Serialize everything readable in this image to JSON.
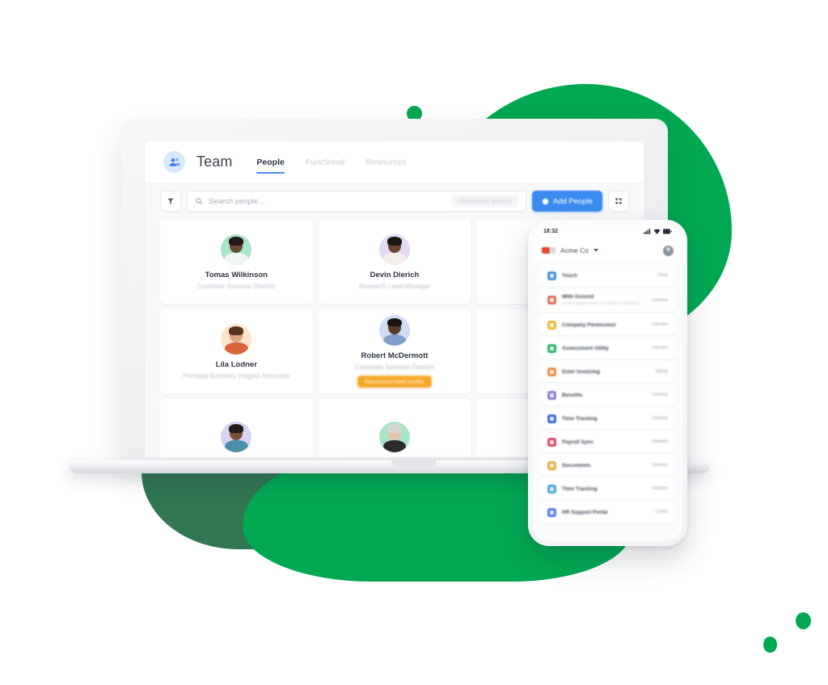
{
  "scene": {
    "brand_green": "#00a851",
    "accent_blue": "#3b8bf0",
    "badge_orange": "#f5a623"
  },
  "laptop_app": {
    "header": {
      "avatar_icon": "people-avatar-icon",
      "title": "Team",
      "tabs": [
        {
          "label": "People",
          "active": true
        },
        {
          "label": "Functional",
          "active": false
        },
        {
          "label": "Resources",
          "active": false
        }
      ]
    },
    "toolbar": {
      "filter_icon": "filter-icon",
      "search_icon": "search-icon",
      "search_value": "",
      "search_placeholder": "Search people...",
      "search_hint": "Advanced search",
      "add_icon": "plus-circle-icon",
      "add_label": "Add People",
      "grid_view_icon": "grid-view-icon"
    },
    "people": [
      {
        "name": "Tomas Wilkinson",
        "role": "Customer Success Director",
        "badge": "",
        "avatar_bg": "#a9e6c9",
        "skin": "#6b4a33",
        "hair": "#221a16",
        "shirt": "#f2f4f6"
      },
      {
        "name": "Devin Dierich",
        "role": "Research Lead Manager",
        "badge": "",
        "avatar_bg": "#e2daf4",
        "skin": "#6a4632",
        "hair": "#1c1614",
        "shirt": "#f5eee8"
      },
      {
        "name": "",
        "role": "",
        "badge": "",
        "avatar_bg": "#e8f0fb",
        "skin": "#c99a78",
        "hair": "#3a2b22",
        "shirt": "#eef1f5"
      },
      {
        "name": "Lila Lodner",
        "role": "Principal Business Insights Associate",
        "badge": "",
        "avatar_bg": "#fbe5cb",
        "skin": "#d9a882",
        "hair": "#5a3423",
        "shirt": "#d9653a"
      },
      {
        "name": "Robert McDermott",
        "role": "Corporate Services Director",
        "badge": "Recommended profile",
        "avatar_bg": "#cfddf6",
        "skin": "#5a3a28",
        "hair": "#171310",
        "shirt": "#7e9ec9"
      },
      {
        "name": "",
        "role": "",
        "badge": "",
        "avatar_bg": "#eef2f8",
        "skin": "#c89a77",
        "hair": "#2d2220",
        "shirt": "#e8ecf2"
      },
      {
        "name": "",
        "role": "",
        "badge": "",
        "avatar_bg": "#d7d3f2",
        "skin": "#7a5238",
        "hair": "#241b17",
        "shirt": "#4c8fa8"
      },
      {
        "name": "",
        "role": "",
        "badge": "",
        "avatar_bg": "#a8e5c6",
        "skin": "#e3c3a6",
        "hair": "#d8d6d4",
        "shirt": "#2c2c30"
      },
      {
        "name": "",
        "role": "",
        "badge": "",
        "avatar_bg": "#eef2f8",
        "skin": "#c89a77",
        "hair": "#2d2220",
        "shirt": "#e8ecf2"
      }
    ]
  },
  "phone_app": {
    "status": {
      "time": "18:32",
      "signal_icon": "signal-bars-icon",
      "wifi_icon": "wifi-icon",
      "battery_icon": "battery-icon"
    },
    "nav": {
      "logo_icon": "acme-logo-icon",
      "workspace": "Acme Co",
      "caret_icon": "chevron-down-icon",
      "account_icon": "account-avatar-icon"
    },
    "rows": [
      {
        "title": "Touch",
        "subtitle": "",
        "meta": "View",
        "icon_color": "#4a90e2",
        "icon_bg": "#dce9fa"
      },
      {
        "title": "With Ground",
        "subtitle": "Lorem ipsum dolor sit amet consectetur",
        "meta": "Review",
        "icon_color": "#e2725b",
        "icon_bg": "#fbe3dd"
      },
      {
        "title": "Company Permission",
        "subtitle": "",
        "meta": "Review",
        "icon_color": "#e8b93a",
        "icon_bg": "#fbf2d6"
      },
      {
        "title": "Assessment Utility",
        "subtitle": "",
        "meta": "Review",
        "icon_color": "#34b36e",
        "icon_bg": "#d9f3e4"
      },
      {
        "title": "Enter Invoicing",
        "subtitle": "",
        "meta": "Setup",
        "icon_color": "#ef8f4a",
        "icon_bg": "#fceadb"
      },
      {
        "title": "Benefits",
        "subtitle": "",
        "meta": "Review",
        "icon_color": "#8a7fd6",
        "icon_bg": "#e6e3f7"
      },
      {
        "title": "Time Tracking",
        "subtitle": "",
        "meta": "Review",
        "icon_color": "#3f6fd8",
        "icon_bg": "#dde5fa"
      },
      {
        "title": "Payroll Sync",
        "subtitle": "",
        "meta": "Review",
        "icon_color": "#e0476b",
        "icon_bg": "#fbdde4"
      },
      {
        "title": "Documents",
        "subtitle": "",
        "meta": "Review",
        "icon_color": "#eab13f",
        "icon_bg": "#fbf0d7"
      },
      {
        "title": "Time Tracking",
        "subtitle": "",
        "meta": "Review",
        "icon_color": "#4aa8dd",
        "icon_bg": "#ddeefa"
      },
      {
        "title": "HR Support Portal",
        "subtitle": "",
        "meta": "Close",
        "icon_color": "#5b7de8",
        "icon_bg": "#dee5fb"
      }
    ]
  }
}
